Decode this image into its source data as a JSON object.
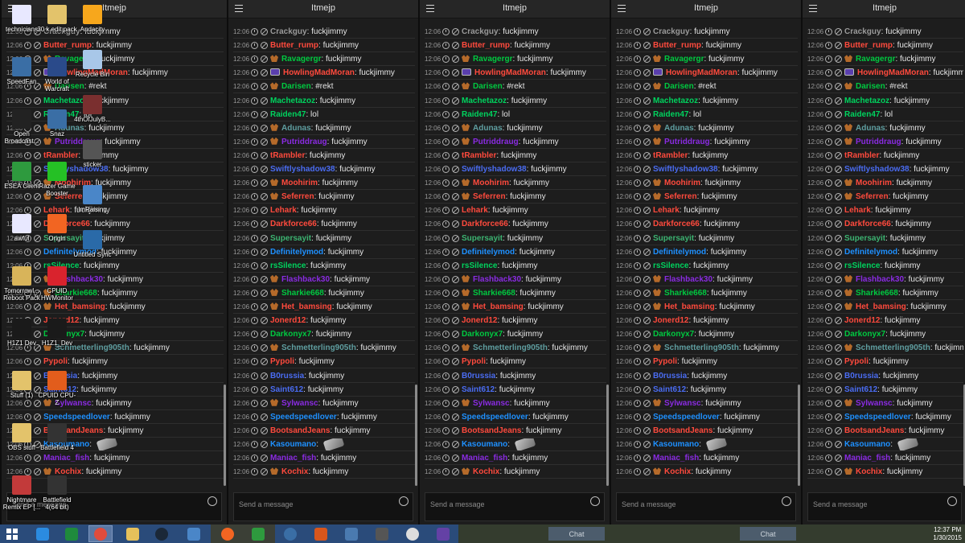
{
  "panel_title": "Itmejp",
  "input_placeholder": "Send a message",
  "timestamp": "12:06",
  "messages": [
    {
      "nick": "Crackguy",
      "text": "fuckjimmy",
      "color": "#9a9a9a",
      "badge": ""
    },
    {
      "nick": "Butter_rump",
      "text": "fuckjimmy",
      "color": "#ff4a3d",
      "badge": ""
    },
    {
      "nick": "Ravagergr",
      "text": "fuckjimmy",
      "color": "#00c940",
      "badge": "sub"
    },
    {
      "nick": "HowlingMadMoran",
      "text": "fuckjimmy",
      "color": "#ff4a3d",
      "badge": "turbo"
    },
    {
      "nick": "Darisen",
      "text": "#rekt",
      "color": "#00c940",
      "badge": "sub"
    },
    {
      "nick": "Machetazoz",
      "text": "fuckjimmy",
      "color": "#00d35e",
      "badge": ""
    },
    {
      "nick": "Raiden47",
      "text": "lol",
      "color": "#00d35e",
      "badge": ""
    },
    {
      "nick": "Adunas",
      "text": "fuckjimmy",
      "color": "#5f9ea0",
      "badge": "sub"
    },
    {
      "nick": "Putriddraug",
      "text": "fuckjimmy",
      "color": "#8a2be2",
      "badge": "sub"
    },
    {
      "nick": "tRambler",
      "text": "fuckjimmy",
      "color": "#ff4a3d",
      "badge": ""
    },
    {
      "nick": "Swiftlyshadow38",
      "text": "fuckjimmy",
      "color": "#4a6cf2",
      "badge": ""
    },
    {
      "nick": "Moohirim",
      "text": "fuckjimmy",
      "color": "#ff4a3d",
      "badge": "sub"
    },
    {
      "nick": "Seferren",
      "text": "fuckjimmy",
      "color": "#ff4a3d",
      "badge": "sub"
    },
    {
      "nick": "Lehark",
      "text": "fuckjimmy",
      "color": "#ff4a3d",
      "badge": ""
    },
    {
      "nick": "Darkforce66",
      "text": "fuckjimmy",
      "color": "#ff4a3d",
      "badge": ""
    },
    {
      "nick": "Supersayit",
      "text": "fuckjimmy",
      "color": "#3cb371",
      "badge": ""
    },
    {
      "nick": "Definitelymod",
      "text": "fuckjimmy",
      "color": "#1e90ff",
      "badge": ""
    },
    {
      "nick": "rsSilence",
      "text": "fuckjimmy",
      "color": "#00d35e",
      "badge": ""
    },
    {
      "nick": "Flashback30",
      "text": "fuckjimmy",
      "color": "#8a2be2",
      "badge": "sub"
    },
    {
      "nick": "Sharkie668",
      "text": "fuckjimmy",
      "color": "#00c940",
      "badge": "sub"
    },
    {
      "nick": "Het_bamsing",
      "text": "fuckjimmy",
      "color": "#ff4a3d",
      "badge": "sub"
    },
    {
      "nick": "Jonerd12",
      "text": "fuckjimmy",
      "color": "#ff4a3d",
      "badge": ""
    },
    {
      "nick": "Darkonyx7",
      "text": "fuckjimmy",
      "color": "#00c940",
      "badge": ""
    },
    {
      "nick": "Schmetterling905th",
      "text": "fuckjimmy",
      "color": "#5f9ea0",
      "badge": "sub"
    },
    {
      "nick": "Pypoli",
      "text": "fuckjimmy",
      "color": "#ff4a3d",
      "badge": ""
    },
    {
      "nick": "B0russia",
      "text": "fuckjimmy",
      "color": "#4a6cf2",
      "badge": ""
    },
    {
      "nick": "Saint612",
      "text": "fuckjimmy",
      "color": "#4a6cf2",
      "badge": ""
    },
    {
      "nick": "Sylwansc",
      "text": "fuckjimmy",
      "color": "#8a2be2",
      "badge": "sub"
    },
    {
      "nick": "Speedspeedlover",
      "text": "fuckjimmy",
      "color": "#1e90ff",
      "badge": ""
    },
    {
      "nick": "BootsandJeans",
      "text": "fuckjimmy",
      "color": "#ff4a3d",
      "badge": ""
    },
    {
      "nick": "Kasoumano",
      "text": "",
      "color": "#1e90ff",
      "badge": "",
      "emote": true
    },
    {
      "nick": "Maniac_fish",
      "text": "fuckjimmy",
      "color": "#8a2be2",
      "badge": ""
    },
    {
      "nick": "Kochix",
      "text": "fuckjimmy",
      "color": "#ff4a3d",
      "badge": "sub"
    }
  ],
  "desktop_icons": [
    {
      "label": "technicians",
      "color": "#e8e8ff"
    },
    {
      "label": "SpeedFan",
      "color": "#3a6ea5"
    },
    {
      "label": "Open Broadcast...",
      "color": "#222"
    },
    {
      "label": "ESEA Client",
      "color": "#2e9a3e"
    },
    {
      "label": "awful",
      "color": "#e8e8ff"
    },
    {
      "label": "Tomorrowl... Reboot Pack",
      "color": "#d8b45a"
    },
    {
      "label": "H1Z1 Dev",
      "color": "#1a1a1a"
    },
    {
      "label": "Stuff (1)",
      "color": "#e3c36b"
    },
    {
      "label": "OBS stuff",
      "color": "#e3c36b"
    },
    {
      "label": "Nightmare Remix EP [...",
      "color": "#c23a3a"
    },
    {
      "label": "30 k edit pack",
      "color": "#e3c36b"
    },
    {
      "label": "World of Warcraft",
      "color": "#2a4a8a"
    },
    {
      "label": "Snaz",
      "color": "#3a6ea5"
    },
    {
      "label": "Razer Game Booster",
      "color": "#25c025"
    },
    {
      "label": "Origin",
      "color": "#f26522"
    },
    {
      "label": "CPUID HWMonitor",
      "color": "#d9232d"
    },
    {
      "label": "H1Z1_Dev",
      "color": "#1a1a1a"
    },
    {
      "label": "CPUID CPU-Z",
      "color": "#e25d1c"
    },
    {
      "label": "Battlefield 4",
      "color": "#333"
    },
    {
      "label": "Battlefield 4(64 bit)",
      "color": "#333"
    },
    {
      "label": "Audacity",
      "color": "#f7a71c"
    },
    {
      "label": "Recycle Bin",
      "color": "#a8c7e8"
    },
    {
      "label": "4thOfJulyB...",
      "color": "#7a2f2f"
    },
    {
      "label": "sticker",
      "color": "#555"
    },
    {
      "label": "ImRaising",
      "color": "#4a86c8"
    },
    {
      "label": "Untitled Sync",
      "color": "#2a6aa8"
    }
  ],
  "taskbar": {
    "chat_label": "Chat",
    "time": "12:37 PM",
    "date": "1/30/2015"
  }
}
